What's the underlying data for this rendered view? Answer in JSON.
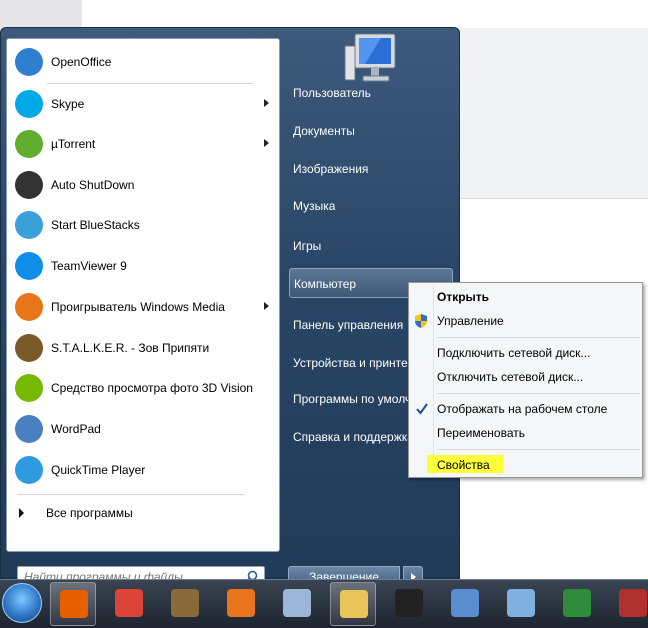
{
  "start_menu": {
    "programs": [
      {
        "label": "OpenOffice",
        "icon": "openoffice-icon",
        "color": "#2f7fd1",
        "arrow": false
      },
      {
        "label": "Skype",
        "icon": "skype-icon",
        "color": "#00a8e6",
        "arrow": true
      },
      {
        "label": "µTorrent",
        "icon": "utorrent-icon",
        "color": "#5fae2e",
        "arrow": true
      },
      {
        "label": "Auto ShutDown",
        "icon": "power-icon",
        "color": "#333333",
        "arrow": false
      },
      {
        "label": "Start BlueStacks",
        "icon": "bluestacks-icon",
        "color": "#3aa0d8",
        "arrow": false
      },
      {
        "label": "TeamViewer 9",
        "icon": "teamviewer-icon",
        "color": "#0e8ee9",
        "arrow": false
      },
      {
        "label": "Проигрыватель Windows Media",
        "icon": "media-player-icon",
        "color": "#e8751a",
        "arrow": true
      },
      {
        "label": "S.T.A.L.K.E.R. - Зов Припяти",
        "icon": "stalker-icon",
        "color": "#7a5a2a",
        "arrow": false
      },
      {
        "label": "Средство просмотра фото 3D Vision",
        "icon": "nvidia-3d-vision-icon",
        "color": "#76b900",
        "arrow": false
      },
      {
        "label": "WordPad",
        "icon": "wordpad-icon",
        "color": "#4a7fc0",
        "arrow": false
      },
      {
        "label": "QuickTime Player",
        "icon": "quicktime-icon",
        "color": "#2e9be0",
        "arrow": false
      }
    ],
    "all_programs_label": "Все программы",
    "search_placeholder": "Найти программы и файлы",
    "right_links": [
      {
        "label": "Пользователь",
        "highlighted": false
      },
      {
        "label": "Документы",
        "highlighted": false
      },
      {
        "label": "Изображения",
        "highlighted": false
      },
      {
        "label": "Музыка",
        "highlighted": false
      },
      {
        "label": "Игры",
        "highlighted": false
      },
      {
        "label": "Компьютер",
        "highlighted": true
      },
      {
        "label": "Панель управления",
        "highlighted": false
      },
      {
        "label": "Устройства и принтеры",
        "highlighted": false
      },
      {
        "label": "Программы по умолчанию",
        "highlighted": false
      },
      {
        "label": "Справка и поддержка",
        "highlighted": false
      }
    ],
    "shutdown_label": "Завершение работы"
  },
  "context_menu": {
    "items": [
      {
        "label": "Открыть",
        "bold": true,
        "icon": null
      },
      {
        "label": "Управление",
        "bold": false,
        "icon": "uac-shield-icon"
      },
      {
        "label": "Подключить сетевой диск...",
        "bold": false,
        "icon": null
      },
      {
        "label": "Отключить сетевой диск...",
        "bold": false,
        "icon": null
      },
      {
        "label": "Отображать на рабочем столе",
        "bold": false,
        "icon": "checkmark-icon"
      },
      {
        "label": "Переименовать",
        "bold": false,
        "icon": null
      },
      {
        "label": "Свойства",
        "bold": false,
        "icon": null,
        "highlight_color": "#ffff3b"
      }
    ]
  },
  "taskbar": {
    "items": [
      {
        "name": "firefox-icon",
        "color": "#e66000",
        "active": true
      },
      {
        "name": "chrome-icon",
        "color": "#db4437",
        "active": false
      },
      {
        "name": "stalker-game-icon",
        "color": "#8a6a3a",
        "active": false
      },
      {
        "name": "pdf-icon",
        "color": "#e8741c",
        "active": false
      },
      {
        "name": "calculator-icon",
        "color": "#9bb6d6",
        "active": false
      },
      {
        "name": "explorer-folder-icon",
        "color": "#e8c45a",
        "active": true
      },
      {
        "name": "obs-icon",
        "color": "#222222",
        "active": false
      },
      {
        "name": "vlc-icon",
        "color": "#5a8cd0",
        "active": false
      },
      {
        "name": "notepad-icon",
        "color": "#7fb0e0",
        "active": false
      },
      {
        "name": "camtasia-icon",
        "color": "#2e8b3a",
        "active": false
      },
      {
        "name": "app-icon",
        "color": "#b03030",
        "active": false
      }
    ]
  }
}
